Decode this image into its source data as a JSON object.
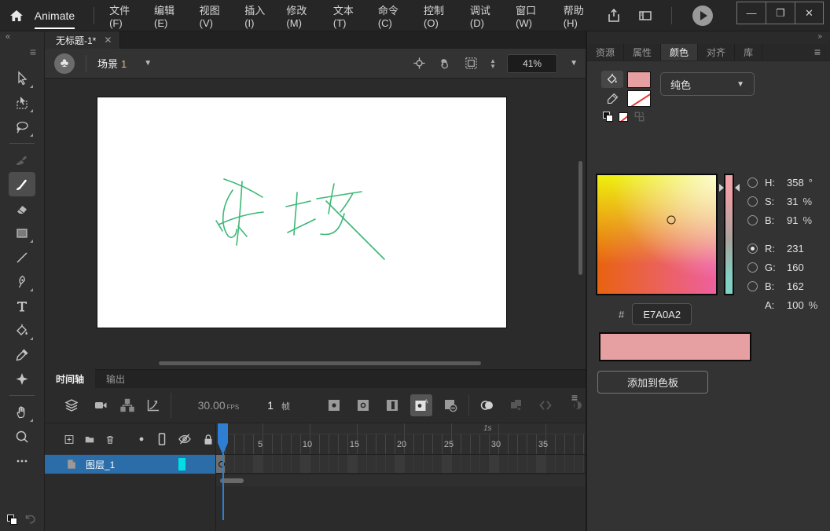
{
  "menubar": {
    "app_name": "Animate",
    "items": [
      "文件(F)",
      "编辑(E)",
      "视图(V)",
      "插入(I)",
      "修改(M)",
      "文本(T)",
      "命令(C)",
      "控制(O)",
      "调试(D)",
      "窗口(W)",
      "帮助(H)"
    ],
    "window_controls": [
      "minimize",
      "maximize",
      "close"
    ],
    "window_control_glyphs": {
      "minimize": "—",
      "maximize": "❐",
      "close": "✕"
    }
  },
  "document": {
    "tab_title": "无标题-1*",
    "close_glyph": "✕"
  },
  "edit_bar": {
    "scene_label": "场景",
    "scene_number": "1",
    "zoom_value": "41%"
  },
  "tools": {
    "selected": "brush",
    "items": [
      "selection",
      "subselection",
      "lasso",
      "fluid-brush",
      "brush",
      "eraser",
      "rectangle",
      "line",
      "pen",
      "text",
      "paint-bucket",
      "eyedropper",
      "asset-warp",
      "hand",
      "zoom",
      "more-tools",
      "swap-colors",
      "undo"
    ]
  },
  "canvas": {
    "stroke_color": "#3cb878",
    "strokes": [
      "M161,104 Q186,112 210,127",
      "M172,118 C158,138 156,162 166,176 C170,181 177,177 177,168",
      "M154,162 C176,152 193,148 211,146",
      "M184,107 C182,140 180,165 177,188",
      "M151,157 L159,170",
      "M179,164 L190,177",
      "M254,121 C253,140 251,158 250,175",
      "M240,139 L271,132",
      "M242,172 C254,166 265,161 277,155",
      "M279,129 L336,120",
      "M301,110 C298,124 296,136 294,148",
      "M325,122 C320,131 315,139 309,146",
      "M291,132 L365,206",
      "M314,148 C309,167 302,177 284,174"
    ]
  },
  "right_panel": {
    "tabs": [
      "资源",
      "属性",
      "颜色",
      "对齐",
      "库"
    ],
    "active_tab": "颜色"
  },
  "color_panel": {
    "mode": "纯色",
    "fill_swatch": "#E7A0A2",
    "stroke_swatch": "none",
    "marker": {
      "x_pct": 62,
      "y_pct": 38
    },
    "rows": [
      {
        "label": "H:",
        "value": "358",
        "unit": "°",
        "selected": false
      },
      {
        "label": "S:",
        "value": "31",
        "unit": "%",
        "selected": false
      },
      {
        "label": "B:",
        "value": "91",
        "unit": "%",
        "selected": false
      },
      {
        "label": "R:",
        "value": "231",
        "unit": "",
        "selected": true,
        "gap": true
      },
      {
        "label": "G:",
        "value": "160",
        "unit": "",
        "selected": false
      },
      {
        "label": "B:",
        "value": "162",
        "unit": "",
        "selected": false
      },
      {
        "label": "A:",
        "value": "100",
        "unit": "%",
        "selected": null
      }
    ],
    "hex_prefix": "#",
    "hex": "E7A0A2",
    "preview_color": "#E7A0A2",
    "add_button": "添加到色板"
  },
  "timeline": {
    "tabs": [
      "时间轴",
      "输出"
    ],
    "active_tab": "时间轴",
    "fps_value": "30.00",
    "fps_label": "FPS",
    "frame_value": "1",
    "frame_label": "帧",
    "second_label": "1s",
    "ruler_numbers": [
      5,
      10,
      15,
      20,
      25,
      30,
      35
    ],
    "total_frames": 39,
    "layer_name": "图层_1",
    "playhead_frame": 1
  },
  "colors": {
    "accent_blue": "#2e7fd4",
    "layer_selection_blue": "#2a6da9",
    "layer_marker_cyan": "#00dde4",
    "pink": "#E7A0A2",
    "green_stroke": "#3cb878"
  }
}
